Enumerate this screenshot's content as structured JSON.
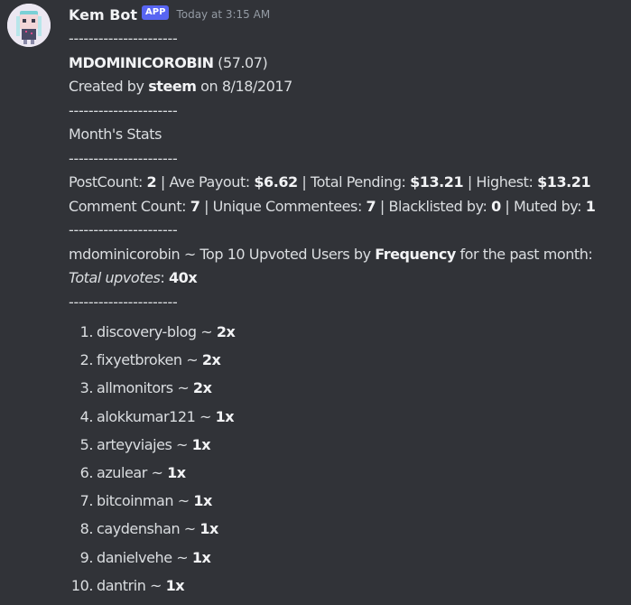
{
  "author": {
    "name": "Kem Bot",
    "badge": "APP",
    "timestamp": "Today at 3:15 AM"
  },
  "separator": "----------------------",
  "profile": {
    "username": "MDOMINICOROBIN",
    "reputation": "(57.07)",
    "created_by_prefix": "Created by",
    "creator": "steem",
    "created_on_prefix": "on",
    "created_date": "8/18/2017"
  },
  "section_title": "Month's Stats",
  "stats": {
    "post_count_label": "PostCount:",
    "post_count": "2",
    "ave_payout_label": "Ave Payout:",
    "ave_payout": "$6.62",
    "total_pending_label": "Total Pending:",
    "total_pending": "$13.21",
    "highest_label": "Highest:",
    "highest": "$13.21",
    "comment_count_label": "Comment Count:",
    "comment_count": "7",
    "unique_commentees_label": "Unique Commentees:",
    "unique_commentees": "7",
    "blacklisted_label": "Blacklisted by:",
    "blacklisted": "0",
    "muted_label": "Muted by:",
    "muted": "1",
    "divider": "|"
  },
  "upvotes": {
    "intro_prefix": "mdominicorobin ~ Top 10 Upvoted Users by",
    "intro_bold": "Frequency",
    "intro_suffix": "for the past month:",
    "total_label": "Total upvotes",
    "total_colon": ":",
    "total_value": "40x",
    "items": [
      {
        "num": "1.",
        "user": "discovery-blog ~",
        "count": "2x"
      },
      {
        "num": "2.",
        "user": "fixyetbroken ~",
        "count": "2x"
      },
      {
        "num": "3.",
        "user": "allmonitors ~",
        "count": "2x"
      },
      {
        "num": "4.",
        "user": "alokkumar121 ~",
        "count": "1x"
      },
      {
        "num": "5.",
        "user": "arteyviajes ~",
        "count": "1x"
      },
      {
        "num": "6.",
        "user": "azulear ~",
        "count": "1x"
      },
      {
        "num": "7.",
        "user": "bitcoinman ~",
        "count": "1x"
      },
      {
        "num": "8.",
        "user": "caydenshan ~",
        "count": "1x"
      },
      {
        "num": "9.",
        "user": "danielvehe ~",
        "count": "1x"
      },
      {
        "num": "10.",
        "user": "dantrin ~",
        "count": "1x"
      }
    ]
  }
}
